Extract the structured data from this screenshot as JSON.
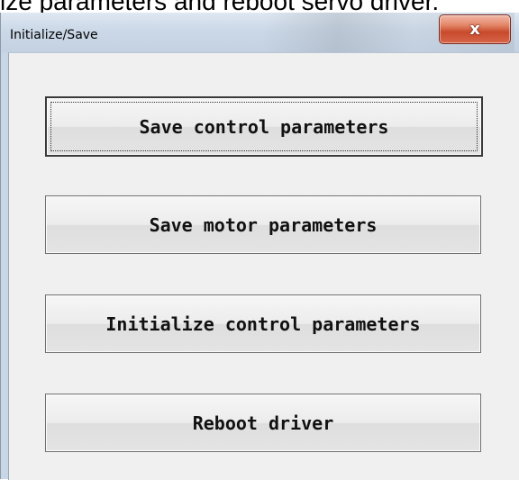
{
  "doc_snippet": "ize parameters and reboot servo driver.",
  "window": {
    "title": "Initialize/Save",
    "close_glyph": "x"
  },
  "buttons": {
    "save_control": "Save control parameters",
    "save_motor": "Save motor parameters",
    "init_control": "Initialize control parameters",
    "reboot": "Reboot driver"
  }
}
